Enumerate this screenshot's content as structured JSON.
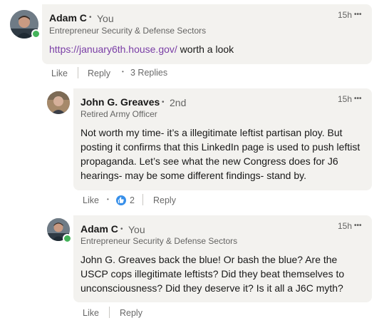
{
  "comments": [
    {
      "name": "Adam C",
      "degree": "You",
      "headline": "Entrepreneur Security & Defense Sectors",
      "time": "15h",
      "link_text": "https://january6th.house.gov/",
      "text_after_link": " worth a look",
      "actions": {
        "like": "Like",
        "reply": "Reply",
        "replies": "3 Replies"
      }
    },
    {
      "name": "John G. Greaves",
      "degree": "2nd",
      "headline": "Retired Army Officer",
      "time": "15h",
      "text": "Not worth my time- it’s a illegitimate leftist partisan ploy. But posting it confirms that this LinkedIn page is used to push leftist propaganda. Let’s see what the new Congress does for J6 hearings- may be some different findings- stand by.",
      "actions": {
        "like": "Like",
        "reaction_count": "2",
        "reply": "Reply"
      }
    },
    {
      "name": "Adam C",
      "degree": "You",
      "headline": "Entrepreneur Security & Defense Sectors",
      "time": "15h",
      "text": "John G. Greaves back the blue! Or bash the blue? Are the USCP cops illegitimate leftists? Did they beat themselves to unconsciousness? Did they deserve it? Is it all a J6C myth?",
      "actions": {
        "like": "Like",
        "reply": "Reply"
      }
    }
  ],
  "more_glyph": "•••",
  "dot": "•",
  "colors": {
    "link": "#7a3ea6",
    "presence": "#44b35a",
    "reaction": "#378fe9",
    "bubble": "#f3f2ef"
  }
}
